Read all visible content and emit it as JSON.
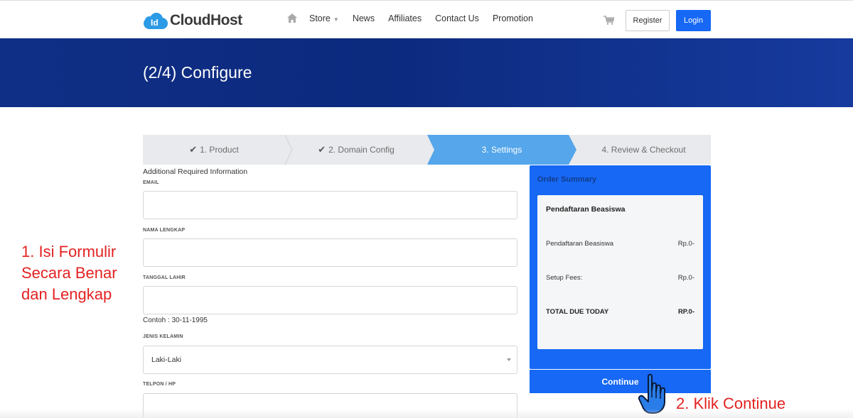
{
  "header": {
    "logo_badge": "Id",
    "logo_text": "CloudHost",
    "nav": [
      "Store",
      "News",
      "Affiliates",
      "Contact Us",
      "Promotion"
    ],
    "register_label": "Register",
    "login_label": "Login"
  },
  "hero": {
    "title": "(2/4) Configure"
  },
  "steps": [
    {
      "label": "1. Product",
      "state": "done"
    },
    {
      "label": "2. Domain Config",
      "state": "done"
    },
    {
      "label": "3. Settings",
      "state": "active"
    },
    {
      "label": "4. Review & Checkout",
      "state": "todo"
    }
  ],
  "form": {
    "section_title": "Additional Required Information",
    "email_label": "EMAIL",
    "name_label": "NAMA LENGKAP",
    "dob_label": "TANGGAL LAHIR",
    "dob_hint": "Contoh : 30-11-1995",
    "gender_label": "JENIS KELAMIN",
    "gender_value": "Laki-Laki",
    "phone_label": "TELPON / HP"
  },
  "summary": {
    "title": "Order Summary",
    "product": "Pendaftaran Beasiswa",
    "rows": [
      {
        "label": "Pendaftaran Beasiswa",
        "value": "Rp.0-"
      },
      {
        "label": "Setup Fees:",
        "value": "Rp.0-"
      }
    ],
    "total_label": "TOTAL DUE TODAY",
    "total_value": "RP.0-",
    "continue_label": "Continue"
  },
  "annotations": {
    "step1_lines": [
      "1. Isi Formulir",
      "Secara Benar",
      "dan Lengkap"
    ],
    "step2": "2. Klik Continue"
  },
  "colors": {
    "primary": "#1668f5",
    "hero_dark": "#0f2f86",
    "step_active": "#55a6ea",
    "step_inactive": "#e8eaed",
    "annotation": "#e32222"
  }
}
